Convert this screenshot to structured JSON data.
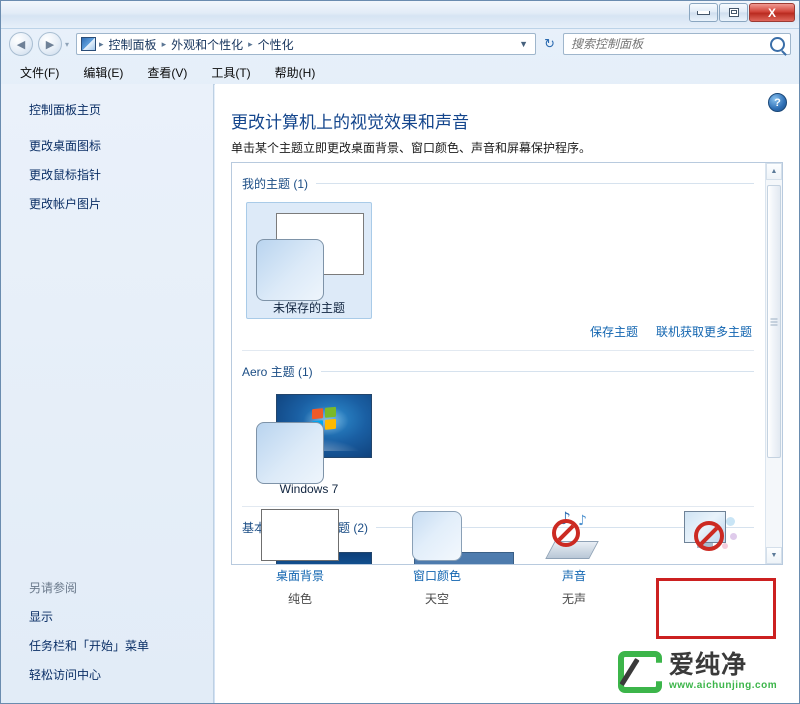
{
  "window": {
    "minimize_label": "最小化",
    "maximize_label": "最大化",
    "close_label": "X"
  },
  "address": {
    "back_glyph": "◀",
    "forward_glyph": "▶",
    "history_glyph": "▾",
    "dropdown_glyph": "▼",
    "refresh_glyph": "↻",
    "crumbs": [
      "控制面板",
      "外观和个性化",
      "个性化"
    ],
    "separator": "▸"
  },
  "search": {
    "placeholder": "搜索控制面板",
    "value": ""
  },
  "menubar": {
    "items": [
      "文件(F)",
      "编辑(E)",
      "查看(V)",
      "工具(T)",
      "帮助(H)"
    ]
  },
  "sidebar": {
    "home": "控制面板主页",
    "links": [
      "更改桌面图标",
      "更改鼠标指针",
      "更改帐户图片"
    ],
    "see_also_title": "另请参阅",
    "see_also": [
      "显示",
      "任务栏和「开始」菜单",
      "轻松访问中心"
    ]
  },
  "main": {
    "help_glyph": "?",
    "heading": "更改计算机上的视觉效果和声音",
    "subheading": "单击某个主题立即更改桌面背景、窗口颜色、声音和屏幕保护程序。",
    "groups": [
      {
        "title": "我的主题 (1)",
        "themes": [
          {
            "label": "未保存的主题",
            "selected": true
          }
        ]
      },
      {
        "title": "Aero 主题 (1)",
        "themes": [
          {
            "label": "Windows 7",
            "selected": false
          }
        ]
      },
      {
        "title": "基本和高对比度主题 (2)",
        "themes": [
          {
            "label": "",
            "selected": false
          },
          {
            "label": "",
            "selected": false
          }
        ]
      }
    ],
    "links": [
      "保存主题",
      "联机获取更多主题"
    ],
    "scroll": {
      "up_glyph": "▲",
      "down_glyph": "▼"
    }
  },
  "bottom": {
    "items": [
      {
        "label": "桌面背景",
        "value": "纯色",
        "icon": "desktop-background-icon"
      },
      {
        "label": "窗口颜色",
        "value": "天空",
        "icon": "window-color-icon"
      },
      {
        "label": "声音",
        "value": "无声",
        "icon": "sound-muted-icon"
      },
      {
        "label": "",
        "value": "",
        "icon": "screensaver-disabled-icon"
      }
    ]
  },
  "watermark": {
    "name": "爱纯净",
    "url": "www.aichunjing.com"
  },
  "colors": {
    "accent_link": "#1265b0",
    "heading": "#13458c",
    "annotation_red": "#cc2020",
    "brand_green": "#3cb54a"
  }
}
